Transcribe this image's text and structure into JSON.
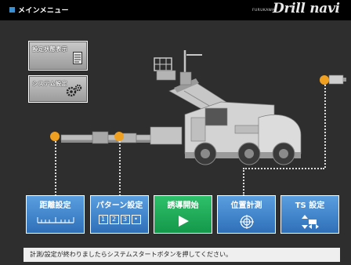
{
  "header": {
    "title": "メインメニュー",
    "brand_small": "FURUKAWA",
    "brand_main": "Drill navi"
  },
  "side_buttons": [
    {
      "label": "設定状態表示",
      "icon": "document-icon"
    },
    {
      "label": "システム設定",
      "icon": "gears-icon"
    }
  ],
  "function_buttons": [
    {
      "label": "距離設定",
      "icon": "ruler-icon",
      "color": "#3f86d0"
    },
    {
      "label": "パターン設定",
      "icon": "pattern-numbers-icon",
      "digits": [
        "1",
        "2",
        "3",
        "•"
      ],
      "color": "#3f86d0"
    },
    {
      "label": "誘導開始",
      "icon": "play-icon",
      "color": "#1fae5a"
    },
    {
      "label": "位置計測",
      "icon": "crosshair-icon",
      "color": "#3f86d0"
    },
    {
      "label": "TS 設定",
      "icon": "move-arrows-icon",
      "color": "#3f86d0"
    }
  ],
  "status_message": "計測/設定が終わりましたらシステムスタートボタンを押してください。",
  "colors": {
    "background": "#2e2e2e",
    "header": "#000000",
    "accent_dot": "#f0a020",
    "button_blue": "#3f86d0",
    "button_green": "#1fae5a"
  }
}
